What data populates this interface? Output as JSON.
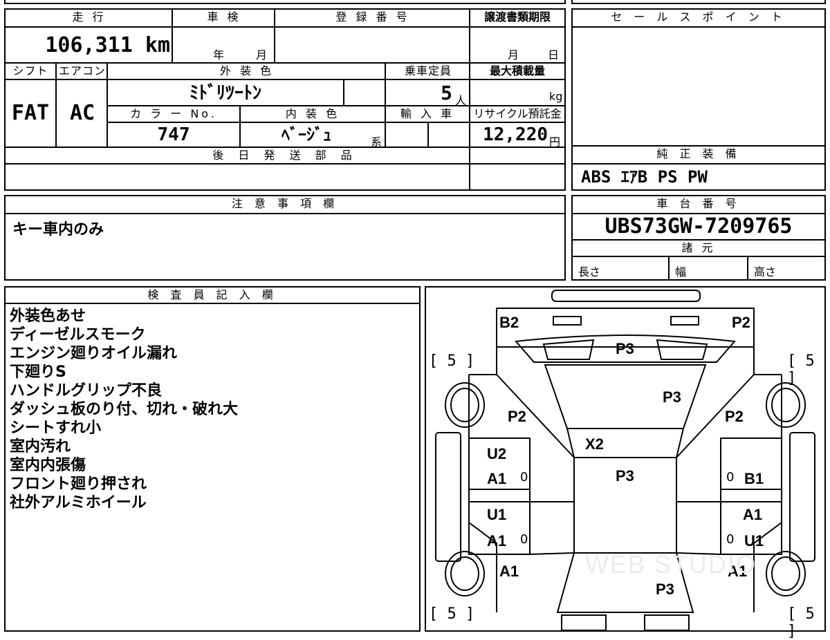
{
  "top": {
    "mileage_label": "走 行",
    "mileage_value": "106,311 km",
    "shaken_label": "車 検",
    "shaken_year_unit": "年",
    "shaken_month_unit": "月",
    "reg_label": "登 録 番 号",
    "transfer_label": "譲渡書類期限",
    "transfer_month_unit": "月",
    "transfer_day_unit": "日",
    "shift_label": "シフト",
    "ac_label": "エアコン",
    "exterior_label": "外 装 色",
    "capacity_label": "乗車定員",
    "loadcap_label": "最大積載量",
    "shift_value": "FAT",
    "ac_value": "AC",
    "exterior_value": "ﾐﾄﾞﾘﾂｰﾄﾝ",
    "capacity_value": "5",
    "capacity_unit": "人",
    "loadcap_unit": "kg",
    "colorno_label": "カ ラ ー No.",
    "interior_label": "内 装 色",
    "import_label": "輸 入 車",
    "recycle_label": "リサイクル預託金",
    "colorno_value": "747",
    "interior_value": "ﾍﾞｰｼﾞｭ",
    "interior_suffix": "系",
    "recycle_value": "12,220",
    "recycle_unit": "円",
    "later_parts_label": "後 日 発 送 部 品"
  },
  "right": {
    "sales_label": "セ ー ル ス ポ イ ン ト",
    "equipment_label": "純 正 装 備",
    "equipment_value": "ABS ｴｱB PS PW",
    "chassis_label": "車 台 番 号",
    "chassis_value": "UBS73GW-7209765",
    "spec_label": "諸 元",
    "length_label": "長さ",
    "width_label": "幅",
    "height_label": "高さ"
  },
  "notes": {
    "label": "注 意 事 項 欄",
    "value": "キー車内のみ"
  },
  "inspector": {
    "label": "検 査 員 記 入 欄",
    "lines": [
      "外装色あせ",
      "ディーゼルスモーク",
      "エンジン廻りオイル漏れ",
      "下廻りS",
      "ハンドルグリップ不良",
      "ダッシュ板のり付、切れ・破れ大",
      "シートすれ小",
      "室内汚れ",
      "室内内張傷",
      "フロント廻り押され",
      "社外アルミホイール"
    ]
  },
  "diagram": {
    "b2": "B2",
    "p2_top": "P2",
    "p3_hood": "P3",
    "p3_windshield": "P3",
    "p2_left": "P2",
    "p2_right": "P2",
    "x2": "X2",
    "p3_roof": "P3",
    "u2": "U2",
    "a1_lf": "A1",
    "b1": "B1",
    "u1_l": "U1",
    "a1_lr": "A1",
    "a1_r": "A1",
    "u1_r": "U1",
    "a1_rl": "A1",
    "a1_rr": "A1",
    "p3_rear": "P3",
    "tire_tl": "[ 5 ]",
    "tire_tr": "[ 5 ]",
    "tire_bl": "[ 5 ]",
    "tire_br": "[ 5 ]",
    "zero": "0",
    "watermark": "WEB STUDIO"
  }
}
